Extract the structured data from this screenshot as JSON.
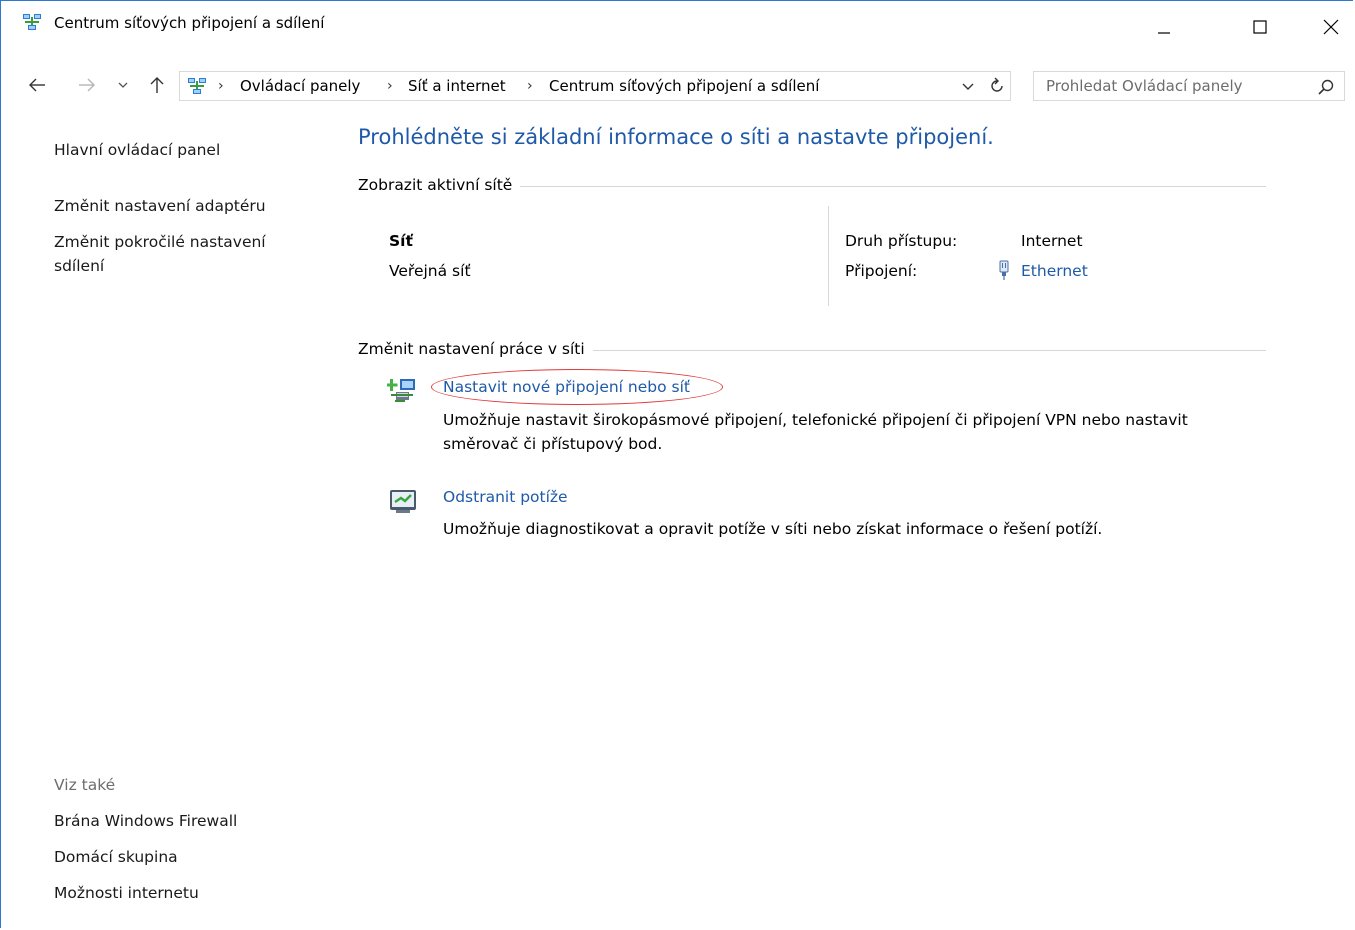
{
  "window": {
    "title": "Centrum síťových připojení a sdílení",
    "icons": {
      "app": "network-center-icon",
      "minimize": "minimize-icon",
      "maximize": "maximize-icon",
      "close": "close-icon"
    }
  },
  "navigation": {
    "back_icon": "arrow-left-icon",
    "forward_icon": "arrow-right-icon",
    "recent_icon": "chevron-down-icon",
    "up_icon": "arrow-up-icon",
    "breadcrumbs": [
      "Ovládací panely",
      "Síť a internet",
      "Centrum síťových připojení a sdílení"
    ],
    "search_placeholder": "Prohledat Ovládací panely"
  },
  "sidebar": {
    "home": "Hlavní ovládací panel",
    "adapter": "Změnit nastavení adaptéru",
    "sharing": "Změnit pokročilé nastavení sdílení",
    "see_also": "Viz také",
    "firewall": "Brána Windows Firewall",
    "homegroup": "Domácí skupina",
    "internet_options": "Možnosti internetu"
  },
  "main": {
    "heading": "Prohlédněte si základní informace o síti a nastavte připojení.",
    "active_networks": {
      "title": "Zobrazit aktivní sítě",
      "network_name": "Síť",
      "network_type": "Veřejná síť",
      "access_label": "Druh přístupu:",
      "access_value": "Internet",
      "connection_label": "Připojení:",
      "connection_value": "Ethernet"
    },
    "change_settings": {
      "title": "Změnit nastavení práce v síti",
      "tasks": [
        {
          "link": "Nastavit nové připojení nebo síť",
          "description": "Umožňuje nastavit širokopásmové připojení, telefonické připojení či připojení VPN nebo nastavit směrovač či přístupový bod.",
          "highlighted": true
        },
        {
          "link": "Odstranit potíže",
          "description": "Umožňuje diagnostikovat a opravit potíže v síti nebo získat informace o řešení potíží."
        }
      ]
    }
  },
  "colors": {
    "link": "#1e5aa8",
    "highlight": "#e03a3a",
    "border": "#2b79d0"
  }
}
